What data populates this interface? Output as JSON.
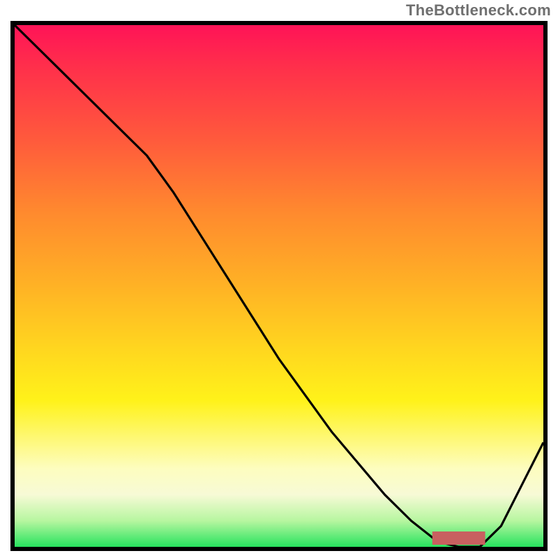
{
  "watermark": "TheBottleneck.com",
  "chart_data": {
    "type": "line",
    "title": "",
    "xlabel": "",
    "ylabel": "",
    "xlim": [
      0,
      100
    ],
    "ylim": [
      0,
      100
    ],
    "grid": false,
    "series": [
      {
        "name": "bottleneck-curve",
        "x": [
          0,
          5,
          10,
          15,
          20,
          25,
          30,
          35,
          40,
          45,
          50,
          55,
          60,
          65,
          70,
          75,
          80,
          84,
          88,
          92,
          96,
          100
        ],
        "values": [
          100,
          95,
          90,
          85,
          80,
          75,
          68,
          60,
          52,
          44,
          36,
          29,
          22,
          16,
          10,
          5,
          1,
          0,
          0,
          4,
          12,
          20
        ]
      }
    ],
    "marker": {
      "x_start": 79,
      "x_end": 89,
      "y": 0,
      "thickness": 2
    },
    "legend": []
  },
  "colors": {
    "gradient_top": "#ff1357",
    "gradient_mid1": "#ff8a2e",
    "gradient_mid2": "#ffd61f",
    "gradient_mid3": "#fdfdbf",
    "gradient_bottom": "#27e35e",
    "marker": "#c86060"
  }
}
